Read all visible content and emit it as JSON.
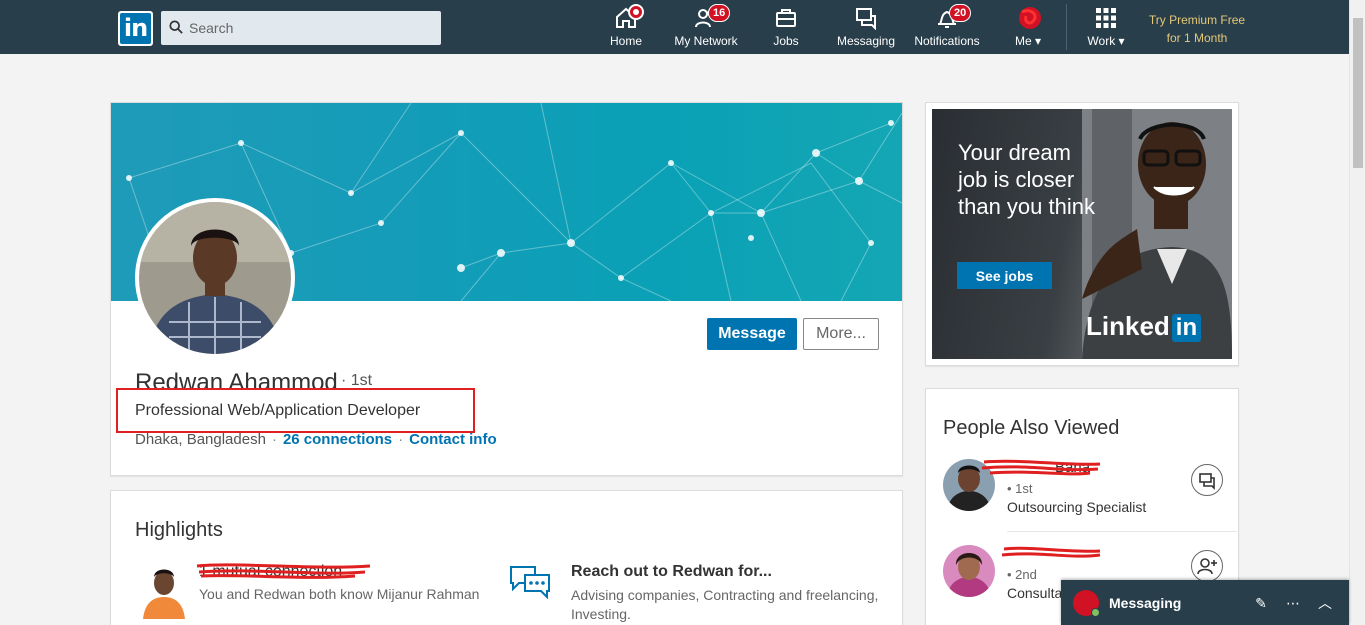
{
  "nav": {
    "logo": "in",
    "search_placeholder": "Search",
    "items": [
      {
        "label": "Home"
      },
      {
        "label": "My Network",
        "badge": "16"
      },
      {
        "label": "Jobs"
      },
      {
        "label": "Messaging"
      },
      {
        "label": "Notifications",
        "badge": "20"
      },
      {
        "label": "Me"
      },
      {
        "label": "Work"
      }
    ],
    "premium_line1": "Try Premium Free",
    "premium_line2": "for 1 Month"
  },
  "profile": {
    "name": "Redwan Ahammod",
    "degree": "· 1st",
    "headline": "Professional Web/Application Developer",
    "location": "Dhaka, Bangladesh",
    "connections": "26 connections",
    "contact": "Contact info",
    "message_button": "Message",
    "more_button": "More..."
  },
  "highlights": {
    "title": "Highlights",
    "mutual_title": "1 mutual connection",
    "mutual_sub": "You and Redwan both know Mijanur Rahman",
    "reach_title": "Reach out to Redwan for...",
    "reach_sub": "Advising companies, Contracting and freelancing, Investing."
  },
  "ad": {
    "headline": "Your dream job is closer than you think",
    "button": "See jobs",
    "logo_text": "Linked",
    "logo_in": "in"
  },
  "people_also_viewed": {
    "title": "People Also Viewed",
    "people": [
      {
        "name": "Bana",
        "degree": "• 1st",
        "role": "Outsourcing Specialist"
      },
      {
        "name": "",
        "degree": "• 2nd",
        "role": "Consultan"
      }
    ]
  },
  "messaging": {
    "label": "Messaging"
  },
  "colors": {
    "nav_bg": "#283e4a",
    "brand_blue": "#0073b1",
    "premium_gold": "#e4c878",
    "badge_red": "#d11124"
  }
}
